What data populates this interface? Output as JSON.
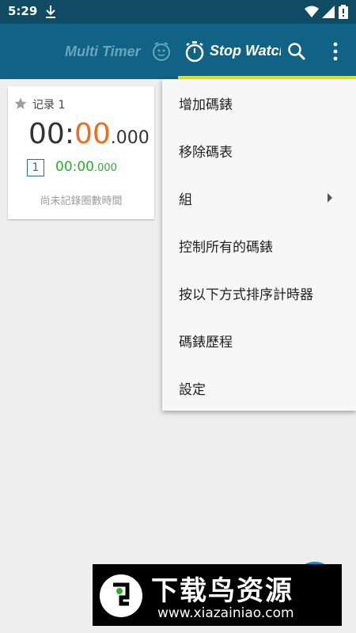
{
  "status_bar": {
    "time": "5:29"
  },
  "app_bar": {
    "tab_multitimer": "Multi Timer",
    "tab_stopwatch": "Stop Watch"
  },
  "card": {
    "title": "记录 1",
    "main_time": {
      "h": "00",
      "colon": ":",
      "m": "00",
      "ms": ".000"
    },
    "lap_number": "1",
    "lap_time": {
      "main": "00:00",
      "ms": ".000"
    },
    "no_laps_text": "尚未記錄圈數時間"
  },
  "menu": {
    "items": [
      {
        "label": "增加碼錶"
      },
      {
        "label": "移除碼表"
      },
      {
        "label": "組"
      },
      {
        "label": "控制所有的碼錶"
      },
      {
        "label": "按以下方式排序計時器"
      },
      {
        "label": "碼錶歷程"
      },
      {
        "label": "設定"
      }
    ]
  },
  "watermark": {
    "title": "下载鸟资源",
    "url": "www.xiazainiao.com"
  },
  "colors": {
    "status_bar": "#0f4b63",
    "app_bar": "#106384",
    "tab_indicator": "#e4e822",
    "orange_digits": "#ea6e22",
    "green_lap": "#2eab2e"
  }
}
